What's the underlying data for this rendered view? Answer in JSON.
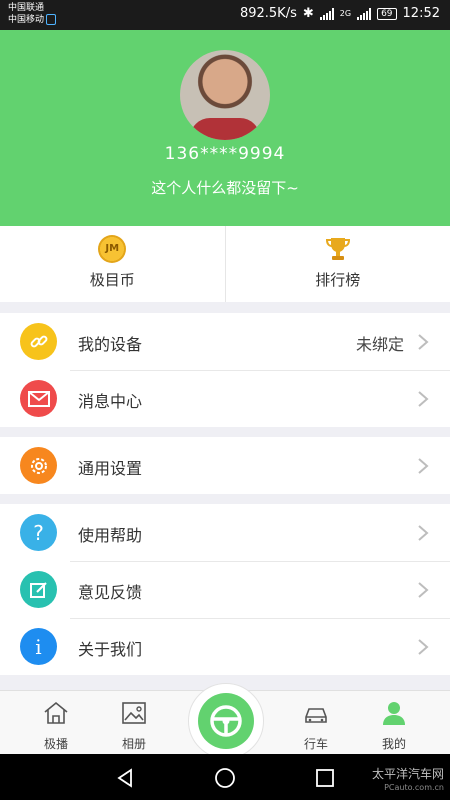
{
  "status_bar": {
    "carrier_1": "中国联通",
    "carrier_2": "中国移动",
    "speed": "892.5K/s",
    "network_type": "2G",
    "battery": "69",
    "time": "12:52"
  },
  "profile": {
    "phone": "136****9994",
    "signature": "这个人什么都没留下~"
  },
  "quick_actions": [
    {
      "label": "极目币",
      "icon": "jm-coin-icon",
      "badge": "JM"
    },
    {
      "label": "排行榜",
      "icon": "trophy-icon"
    }
  ],
  "menu": {
    "group1": [
      {
        "label": "我的设备",
        "value": "未绑定",
        "icon": "link-icon",
        "color": "#f7c31b"
      },
      {
        "label": "消息中心",
        "icon": "mail-icon",
        "color": "#ef4b4b"
      }
    ],
    "group2": [
      {
        "label": "通用设置",
        "icon": "gear-icon",
        "color": "#f7871e"
      }
    ],
    "group3": [
      {
        "label": "使用帮助",
        "icon": "question-icon",
        "color": "#39b1e7"
      },
      {
        "label": "意见反馈",
        "icon": "edit-icon",
        "color": "#28c1b0"
      },
      {
        "label": "关于我们",
        "icon": "info-icon",
        "color": "#1e8df0"
      }
    ]
  },
  "bottom_nav": [
    {
      "label": "极播",
      "icon": "home-icon"
    },
    {
      "label": "相册",
      "icon": "album-icon"
    },
    {
      "label": "行车",
      "icon": "car-icon"
    },
    {
      "label": "我的",
      "icon": "user-icon",
      "active": true
    }
  ],
  "center_button": {
    "icon": "steering-wheel-icon"
  },
  "watermark": {
    "line1": "太平洋汽车网",
    "line2": "PCauto.com.cn"
  },
  "colors": {
    "brand_green": "#62d26f"
  }
}
